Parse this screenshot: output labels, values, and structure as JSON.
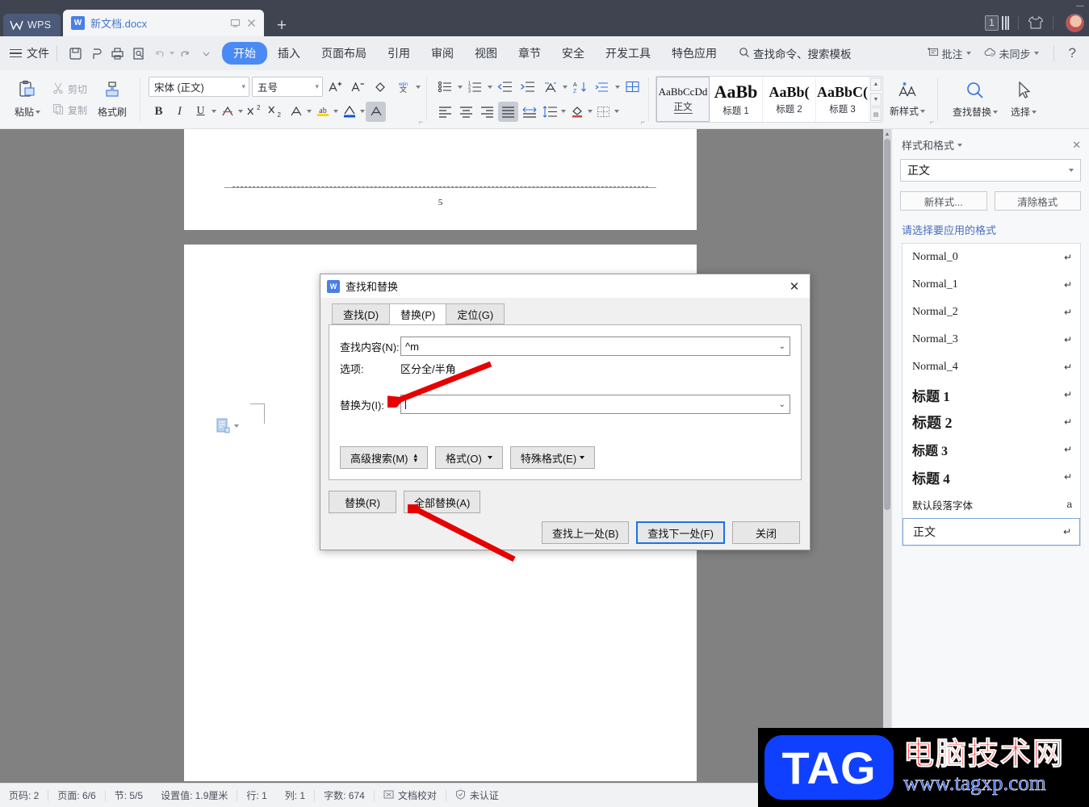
{
  "titlebar": {
    "app_button": "WPS",
    "tab_name": "新文档.docx",
    "tab_restore_icon": "restore-window-icon",
    "tab_close_icon": "close-icon",
    "new_tab_icon": "plus-icon",
    "badge_count": "1",
    "theme_icon": "t-shirt-icon",
    "avatar_icon": "user-avatar"
  },
  "menubar": {
    "file_label": "文件",
    "quick_icons": [
      "save-icon",
      "print-preview-icon",
      "print-icon",
      "search-doc-icon",
      "undo-icon",
      "redo-icon",
      "customize-icon"
    ],
    "items": [
      {
        "label": "开始",
        "active": true
      },
      {
        "label": "插入",
        "active": false
      },
      {
        "label": "页面布局",
        "active": false
      },
      {
        "label": "引用",
        "active": false
      },
      {
        "label": "审阅",
        "active": false
      },
      {
        "label": "视图",
        "active": false
      },
      {
        "label": "章节",
        "active": false
      },
      {
        "label": "安全",
        "active": false
      },
      {
        "label": "开发工具",
        "active": false
      },
      {
        "label": "特色应用",
        "active": false
      }
    ],
    "search_placeholder": "查找命令、搜索模板",
    "comment_label": "批注",
    "sync_label": "未同步",
    "help_icon": "question-mark-icon"
  },
  "ribbon": {
    "paste_label": "粘贴",
    "cut_label": "剪切",
    "copy_label": "复制",
    "format_painter_label": "格式刷",
    "font_name": "宋体 (正文)",
    "font_size": "五号",
    "font_tools": [
      "grow-font-icon",
      "shrink-font-icon",
      "clear-format-icon",
      "pinyin-guide-icon"
    ],
    "format_tools": [
      "bold-icon",
      "italic-icon",
      "underline-icon",
      "strikethrough-icon",
      "superscript-icon",
      "subscript-icon",
      "character-border-icon",
      "highlight-icon",
      "font-color-icon",
      "character-shading-icon"
    ],
    "paragraph_tools_row1": [
      "bullets-icon",
      "numbering-icon",
      "decrease-indent-icon",
      "increase-indent-icon",
      "phonetic-icon",
      "sort-icon",
      "show-marks-icon",
      "table-grid-icon"
    ],
    "paragraph_tools_row2": [
      "align-left-icon",
      "align-center-icon",
      "align-right-icon",
      "justify-icon",
      "distribute-icon",
      "line-spacing-icon",
      "shading-icon",
      "borders-icon"
    ],
    "styles": [
      {
        "preview": "AaBbCcDd",
        "name": "正文",
        "selected": true,
        "size": "small"
      },
      {
        "preview": "AaBb",
        "name": "标题 1",
        "selected": false,
        "size": "big"
      },
      {
        "preview": "AaBb(",
        "name": "标题 2",
        "selected": false,
        "size": "mid"
      },
      {
        "preview": "AaBbC(",
        "name": "标题 3",
        "selected": false,
        "size": "mid"
      }
    ],
    "new_style_label": "新样式",
    "find_replace_label": "查找替换",
    "select_label": "选择"
  },
  "document": {
    "page1_number": "5",
    "paste_options_icon": "paste-options-icon"
  },
  "taskpane": {
    "title": "样式和格式",
    "close_icon": "close-icon",
    "current_style": "正文",
    "new_style_button": "新样式...",
    "clear_format_button": "清除格式",
    "section_label": "请选择要应用的格式",
    "styles": [
      {
        "name": "Normal_0",
        "mark": "↵",
        "kind": "normal",
        "selected": false
      },
      {
        "name": "Normal_1",
        "mark": "↵",
        "kind": "normal",
        "selected": false
      },
      {
        "name": "Normal_2",
        "mark": "↵",
        "kind": "normal",
        "selected": false
      },
      {
        "name": "Normal_3",
        "mark": "↵",
        "kind": "normal",
        "selected": false
      },
      {
        "name": "Normal_4",
        "mark": "↵",
        "kind": "normal",
        "selected": false
      },
      {
        "name": "标题 1",
        "mark": "↵",
        "kind": "h1",
        "selected": false
      },
      {
        "name": "标题 2",
        "mark": "↵",
        "kind": "h2",
        "selected": false
      },
      {
        "name": "标题 3",
        "mark": "↵",
        "kind": "h3",
        "selected": false
      },
      {
        "name": "标题 4",
        "mark": "↵",
        "kind": "h4",
        "selected": false
      },
      {
        "name": "默认段落字体",
        "mark": "a",
        "kind": "small",
        "selected": false
      },
      {
        "name": "正文",
        "mark": "↵",
        "kind": "normal",
        "selected": true
      }
    ]
  },
  "dialog": {
    "title": "查找和替换",
    "icon": "wps-writer-icon",
    "close_icon": "close-icon",
    "tabs": [
      {
        "label": "查找(D)",
        "active": false
      },
      {
        "label": "替换(P)",
        "active": true
      },
      {
        "label": "定位(G)",
        "active": false
      }
    ],
    "find_label": "查找内容(N):",
    "find_value": "^m",
    "find_placeholder": "",
    "options_label": "选项:",
    "options_value": "区分全/半角",
    "replace_label": "替换为(I):",
    "replace_value": "",
    "replace_placeholder": "",
    "advanced_search_button": "高级搜索(M)",
    "format_button": "格式(O)",
    "special_format_button": "特殊格式(E)",
    "replace_button": "替换(R)",
    "replace_all_button": "全部替换(A)",
    "find_prev_button": "查找上一处(B)",
    "find_next_button": "查找下一处(F)",
    "close_button": "关闭"
  },
  "statusbar": {
    "items": [
      {
        "text": "页码: 2",
        "icon": ""
      },
      {
        "text": "页面: 6/6",
        "icon": ""
      },
      {
        "text": "节: 5/5",
        "icon": ""
      },
      {
        "text": "设置值: 1.9厘米",
        "icon": ""
      },
      {
        "text": "行: 1",
        "icon": ""
      },
      {
        "text": "列: 1",
        "icon": ""
      },
      {
        "text": "字数: 674",
        "icon": ""
      },
      {
        "text": "文档校对",
        "icon": "proofread-icon"
      },
      {
        "text": "未认证",
        "icon": "shield-icon"
      }
    ]
  },
  "watermark": {
    "logo_text": "TAG",
    "site_name": "电脑技术网",
    "site_url": "www.tagxp.com"
  },
  "colors": {
    "titlebar_bg": "#3f4450",
    "accent_blue": "#4a8af4",
    "link_blue": "#4a6fc0",
    "arrow_red": "#e60000",
    "dialog_bg": "#f0f0f0"
  }
}
